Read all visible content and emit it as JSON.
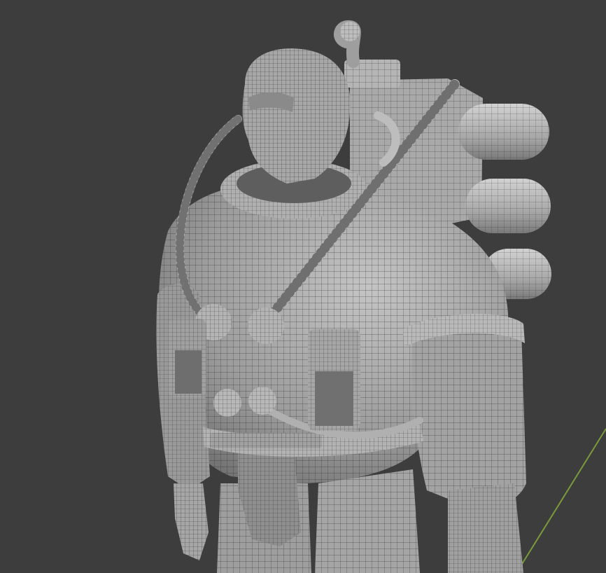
{
  "viewport": {
    "background_color": "#3d3d3d",
    "mesh_fill": "#9a9a9a",
    "mesh_shade": "#6e6e6e",
    "mesh_highlight": "#c2c2c2",
    "wire_color": "#222222",
    "axis_line_color": "#7a9a3a",
    "subject": "diver-character-wireframe-mesh"
  }
}
